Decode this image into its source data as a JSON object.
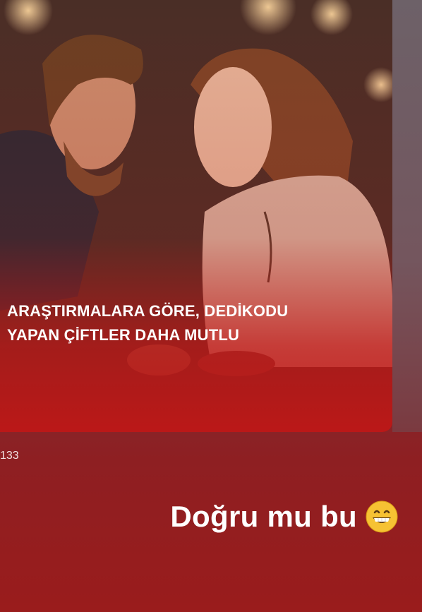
{
  "story": {
    "headline_line1": "ARAŞTIRMALARA GÖRE, DEDİKODU",
    "headline_line2": "YAPAN ÇİFTLER DAHA MUTLU",
    "counter": "133"
  },
  "caption": {
    "text": "Doğru mu bu",
    "emoji": "grinning-face-emoji"
  },
  "colors": {
    "accent_red": "#c11717",
    "background_top": "#6a4a55",
    "background_bottom": "#9a1c1c"
  }
}
